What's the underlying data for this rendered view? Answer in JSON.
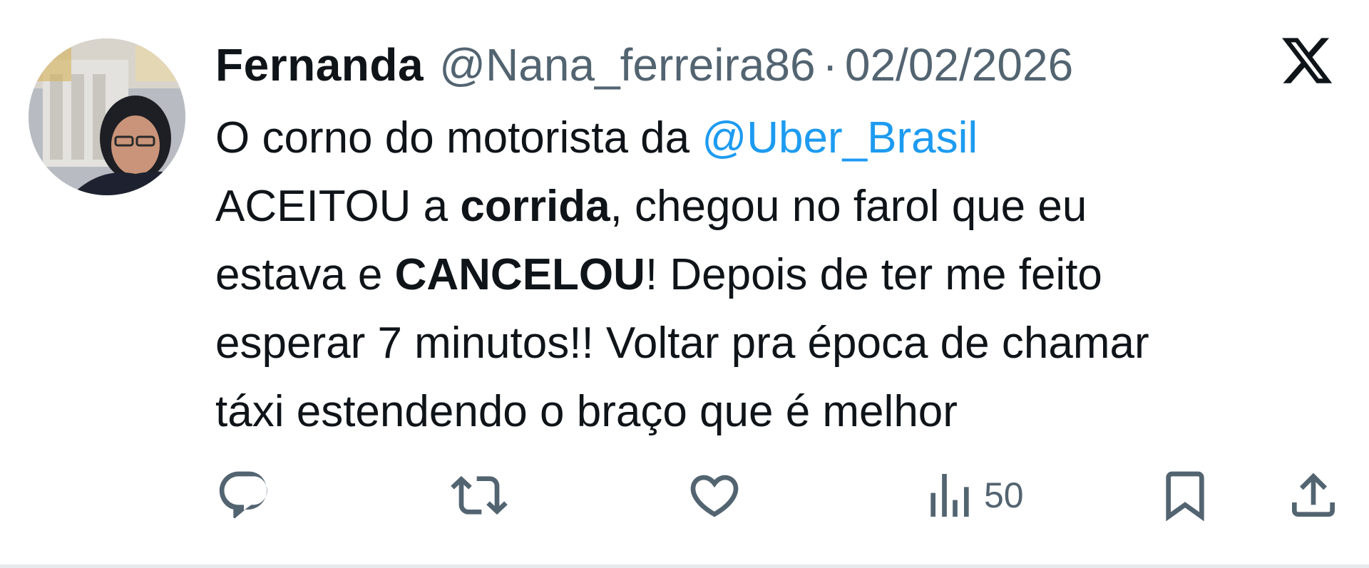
{
  "tweet": {
    "display_name": "Fernanda",
    "handle": "@Nana_ferreira86",
    "separator": "·",
    "date": "02/02/2026",
    "platform_icon": "x-logo-icon",
    "avatar_icon": "profile-photo",
    "body": {
      "line1": {
        "text": "O corno do motorista da ",
        "mention": "@Uber_Brasil"
      },
      "line2": {
        "part1": "ACEITOU a ",
        "bold": "corrida",
        "part2": ", chegou no farol que eu"
      },
      "line3": {
        "part1": "estava e ",
        "bold": "CANCELOU",
        "part2": "! Depois de ter me feito"
      },
      "line4": "esperar 7 minutos!! Voltar pra época de chamar",
      "line5": "táxi estendendo o braço que é melhor"
    },
    "actions": {
      "reply_icon": "reply-icon",
      "retweet_icon": "retweet-icon",
      "like_icon": "heart-icon",
      "views_icon": "views-icon",
      "views_count": "50",
      "bookmark_icon": "bookmark-icon",
      "share_icon": "share-icon"
    }
  },
  "colors": {
    "text": "#0f1419",
    "secondary": "#536471",
    "mention": "#1d9bf0",
    "background": "#ffffff",
    "divider": "#e7e9ea"
  }
}
